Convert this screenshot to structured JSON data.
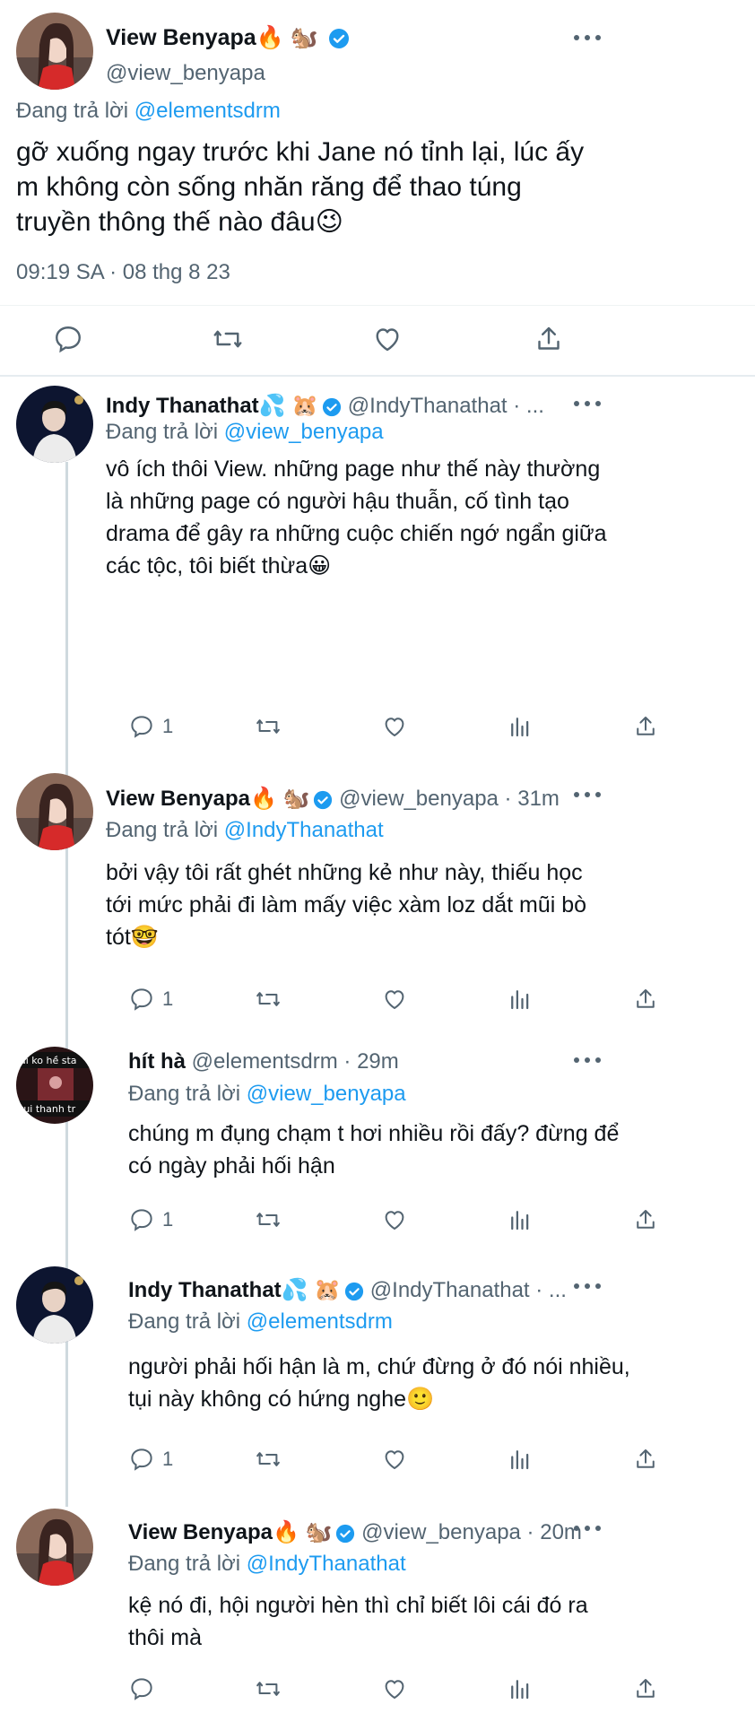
{
  "main_tweet": {
    "name": "View Benyapa🔥 🐿️",
    "handle": "@view_benyapa",
    "reply_prefix": "Đang trả lời",
    "reply_to": "@elementsdrm",
    "text_lines": [
      "gỡ xuống ngay trước khi Jane nó tỉnh lại, lúc ấy",
      "m không còn sống nhăn răng để thao túng",
      "truyền thông thế nào đâu😉"
    ],
    "timestamp": "09:19 SA · 08 thg 8 23"
  },
  "replies": [
    {
      "name": "Indy Thanathat💦 🐹",
      "handle_time": "@IndyThanathat · ...",
      "reply_prefix": "Đang trả lời",
      "reply_to": "@view_benyapa",
      "text_lines": [
        "vô ích thôi View. những page như thế này thường",
        "là những page có người hậu thuẫn, cố tình tạo",
        "drama để gây ra những cuộc chiến ngớ ngẩn giữa",
        "các tộc, tôi biết thừa😀"
      ],
      "reply_count": "1"
    },
    {
      "name": "View Benyapa🔥 🐿️",
      "handle_time": "@view_benyapa · 31m",
      "reply_prefix": "Đang trả lời",
      "reply_to": "@IndyThanathat",
      "text_lines": [
        "bởi vậy tôi rất ghét những kẻ như này, thiếu học",
        "tới mức phải đi làm mấy việc xàm loz dắt mũi bò",
        "tót🤓"
      ],
      "reply_count": "1"
    },
    {
      "name": "hít hà",
      "handle_time": "@elementsdrm · 29m",
      "reply_prefix": "Đang trả lời",
      "reply_to": "@view_benyapa",
      "text_lines": [
        "chúng m đụng chạm t hơi nhiều rồi đấy? đừng để",
        "có ngày phải hối hận"
      ],
      "reply_count": "1"
    },
    {
      "name": "Indy Thanathat💦 🐹",
      "handle_time": "@IndyThanathat · ...",
      "reply_prefix": "Đang trả lời",
      "reply_to": "@elementsdrm",
      "text_lines": [
        "người phải hối hận là m, chứ đừng ở đó nói nhiều,",
        "tụi này không có hứng nghe🙂"
      ],
      "reply_count": "1"
    },
    {
      "name": "View Benyapa🔥 🐿️",
      "handle_time": "@view_benyapa · 20m",
      "reply_prefix": "Đang trả lời",
      "reply_to": "@IndyThanathat",
      "text_lines": [
        "kệ nó đi, hội người hèn thì chỉ biết lôi cái đó ra",
        "thôi mà"
      ],
      "reply_count": ""
    }
  ],
  "avatar_overlay_text": {
    "line1": "ai ko hề sta",
    "line2": "tụi thanh tr"
  },
  "colors": {
    "link": "#1d9bf0",
    "muted": "#536471",
    "verified": "#1d9bf0"
  }
}
